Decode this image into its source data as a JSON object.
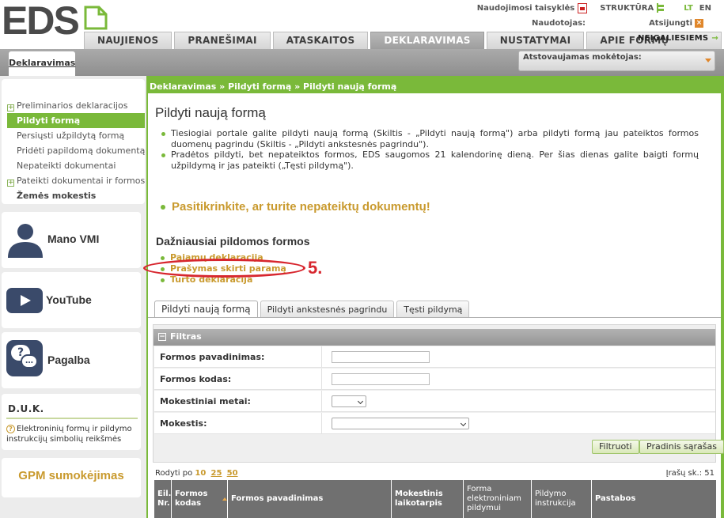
{
  "header": {
    "logo_text": "EDS",
    "util": {
      "templates": "Naudojimosi taisyklės",
      "structure": "STRUKTŪRA",
      "lang_lt": "LT",
      "lang_en": "EN"
    },
    "user_label": "Naudotojas:",
    "logout": "Atsijungti",
    "nav_tabs": [
      "NAUJIENOS",
      "PRANEŠIMAI",
      "ATASKAITOS",
      "DEKLARAVIMAS",
      "NUSTATYMAI",
      "APIE FORMŲ TEIKIMĄ"
    ],
    "nav_right": "NEĮGALIESIEMS",
    "sub_tab": "Deklaravimas",
    "payer_label": "Atstovaujamas mokėtojas:"
  },
  "sidebar": {
    "items": [
      {
        "label": "Preliminarios deklaracijos",
        "plus": true
      },
      {
        "label": "Pildyti formą",
        "active": true
      },
      {
        "label": "Persiųsti užpildytą formą"
      },
      {
        "label": "Pridėti papildomą dokumentą"
      },
      {
        "label": "Nepateikti dokumentai"
      },
      {
        "label": "Pateikti dokumentai ir formos",
        "plus": true
      },
      {
        "label": "Žemės mokestis",
        "bold": true
      }
    ],
    "promos": {
      "vmi": "Mano VMI",
      "youtube": "YouTube",
      "help": "Pagalba"
    },
    "duk": {
      "title": "D.U.K.",
      "text": "Elektroninių formų ir pildymo instrukcijų simbolių reikšmės"
    },
    "gpm": "GPM sumokėjimas"
  },
  "main": {
    "breadcrumb": "Deklaravimas » Pildyti formą » Pildyti naują formą",
    "title": "Pildyti naują formą",
    "intro": [
      "Tiesiogiai portale galite pildyti naują formą (Skiltis - „Pildyti naują formą\") arba pildyti formą jau pateiktos formos duomenų pagrindu (Skiltis - „Pildyti ankstesnės pagrindu\").",
      "Pradėtos pildyti, bet nepateiktos formos, EDS saugomos 21 kalendorinę dieną. Per šias dienas galite baigti formų užpildymą ir jas pateikti („Tęsti pildymą\")."
    ],
    "check_docs": "Pasitikrinkite, ar turite nepateiktų dokumentų!",
    "freq_title": "Dažniausiai pildomos formos",
    "freq_items": [
      "Pajamų deklaracija",
      "Prašymas skirti paramą",
      "Turto deklaracija"
    ],
    "annotation": "5.",
    "tabs": [
      "Pildyti naują formą",
      "Pildyti ankstesnės pagrindu",
      "Tęsti pildymą"
    ],
    "filter": {
      "title": "Filtras",
      "fields": [
        {
          "label": "Formos pavadinimas:"
        },
        {
          "label": "Formos kodas:"
        },
        {
          "label": "Mokestiniai metai:"
        },
        {
          "label": "Mokestis:"
        }
      ],
      "btn_filter": "Filtruoti",
      "btn_reset": "Pradinis sąrašas"
    },
    "pager": {
      "prefix": "Rodyti po",
      "opts": [
        "10",
        "25",
        "50"
      ],
      "count": "Įrašų sk.: 51"
    },
    "table_headers": [
      "Eil. Nr.",
      "Formos kodas",
      "Formos pavadinimas",
      "Mokestinis laikotarpis",
      "Forma elektroniniam pildymui",
      "Pildymo instrukcija",
      "Pastabos"
    ]
  },
  "colors": {
    "green": "#7ab93a",
    "gold": "#c99a2e",
    "red": "#d7262e"
  }
}
